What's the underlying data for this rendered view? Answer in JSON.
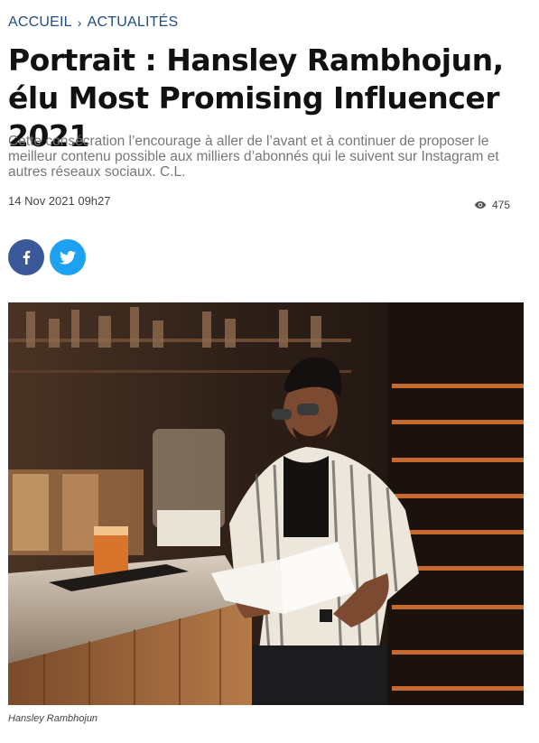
{
  "breadcrumb": {
    "home": "ACCUEIL",
    "section": "ACTUALITÉS"
  },
  "article": {
    "title": "Portrait : Hansley Rambhojun, élu Most Promising Influencer 2021",
    "lead": "Cette consécration l’encourage à aller de l’avant et à continuer de proposer le meilleur contenu possible aux milliers d’abonnés qui le suivent sur Instagram et autres réseaux sociaux. C.L.",
    "date": "14 Nov 2021 09h27",
    "views": "475",
    "photo_caption": "Hansley Rambhojun"
  },
  "share": {
    "facebook_icon": "facebook-icon",
    "twitter_icon": "twitter-icon"
  },
  "colors": {
    "breadcrumb": "#1f4d87",
    "facebook": "#3b5998",
    "twitter": "#1da1f2"
  }
}
